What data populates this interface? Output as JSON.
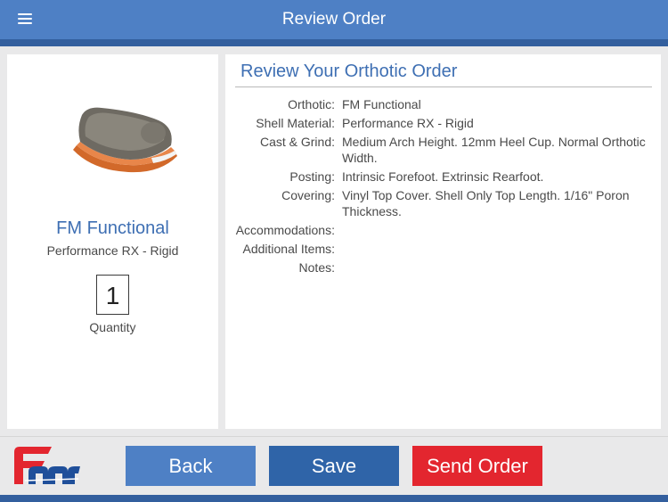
{
  "header": {
    "title": "Review Order"
  },
  "product": {
    "name": "FM Functional",
    "material": "Performance RX - Rigid",
    "quantity": "1",
    "quantity_label": "Quantity"
  },
  "review": {
    "title": "Review Your Orthotic Order",
    "rows": [
      {
        "label": "Orthotic:",
        "value": "FM Functional"
      },
      {
        "label": "Shell Material:",
        "value": "Performance RX - Rigid"
      },
      {
        "label": "Cast & Grind:",
        "value": "Medium Arch Height. 12mm Heel Cup.  Normal Orthotic Width."
      },
      {
        "label": "Posting:",
        "value": "Intrinsic Forefoot. Extrinsic Rearfoot."
      },
      {
        "label": "Covering:",
        "value": "Vinyl Top Cover. Shell Only Top Length. 1/16\" Poron Thickness."
      },
      {
        "label": "Accommodations:",
        "value": ""
      },
      {
        "label": "Additional Items:",
        "value": ""
      },
      {
        "label": "Notes:",
        "value": ""
      }
    ]
  },
  "footer": {
    "back_label": "Back",
    "save_label": "Save",
    "send_label": "Send Order",
    "logo_icon": "fmr-logo"
  },
  "colors": {
    "header_blue": "#4e80c5",
    "header_dark": "#335f9e",
    "accent_blue": "#3e6fb3",
    "save_blue": "#2f64a8",
    "send_red": "#e3262f"
  },
  "icons": {
    "menu": "menu-icon",
    "product": "insole-image"
  }
}
